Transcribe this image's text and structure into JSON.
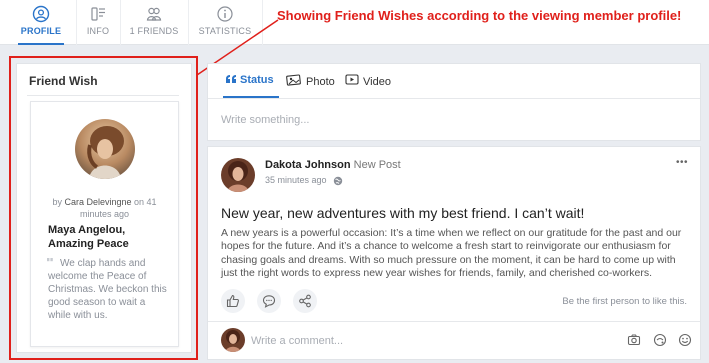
{
  "tabs": [
    {
      "label": "PROFILE",
      "icon": "user-circle-icon",
      "active": true
    },
    {
      "label": "INFO",
      "icon": "info-list-icon",
      "active": false
    },
    {
      "label": "1 FRIENDS",
      "icon": "friends-icon",
      "active": false
    },
    {
      "label": "STATISTICS",
      "icon": "info-circle-icon",
      "active": false
    }
  ],
  "annotation": "Showing Friend Wishes according to the viewing member profile!",
  "friend_wish": {
    "title": "Friend Wish",
    "by_prefix": "by",
    "by_name": "Cara Delevingne",
    "by_suffix": "on 41 minutes ago",
    "heading": "Maya Angelou, Amazing Peace",
    "body": "We clap hands and welcome the Peace of Christmas. We beckon this good season to wait a while with us."
  },
  "composer": {
    "tabs": [
      {
        "label": "Status",
        "icon": "quote-icon"
      },
      {
        "label": "Photo",
        "icon": "photo-icon"
      },
      {
        "label": "Video",
        "icon": "video-icon"
      }
    ],
    "placeholder": "Write something..."
  },
  "post": {
    "author": "Dakota Johnson",
    "action": "New Post",
    "time": "35 minutes ago",
    "more": "•••",
    "headline": "New year, new adventures with my best friend. I can’t wait!",
    "body": "A new years is a powerful occasion: It’s a time when we reflect on our gratitude for the past and our hopes for the future. And it’s a chance to welcome a fresh start to reinvigorate our enthusiasm for chasing goals and dreams. With so much pressure on the moment, it can be hard to come up with just the right words to express new year wishes for friends, family, and cherished co-workers.",
    "like_text": "Be the first person to like this.",
    "comment_placeholder": "Write a comment..."
  },
  "colors": {
    "accent": "#2a74c9",
    "annotation": "#e0201b",
    "background": "#e9ecf1"
  }
}
